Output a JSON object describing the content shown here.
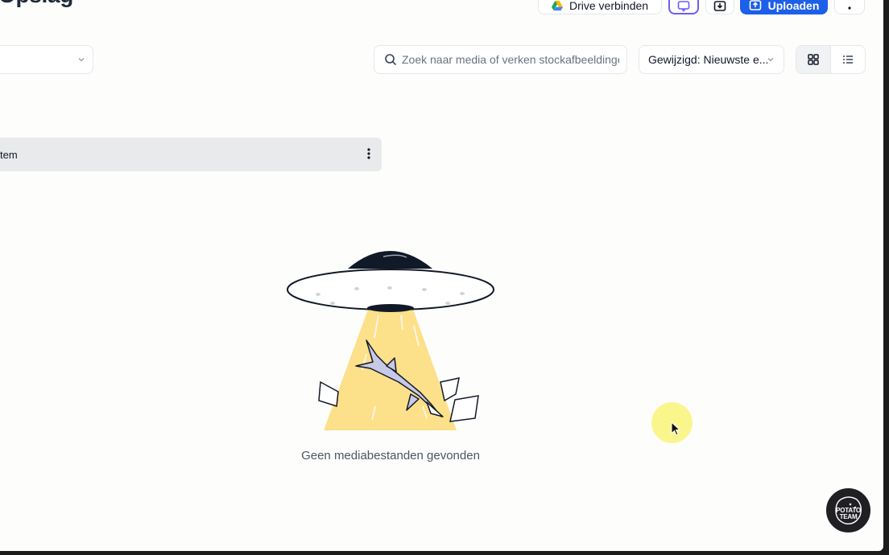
{
  "header": {
    "title": "Opslag",
    "drive_button": "Drive verbinden",
    "upload_button": "Uploaden"
  },
  "toolbar": {
    "search_placeholder": "Zoek naar media of verken stockafbeeldingen",
    "sort_label": "Gewijzigd: Nieuwste e...",
    "view_modes": [
      "grid",
      "list"
    ],
    "active_view": "grid"
  },
  "folder_row": {
    "label": "tem"
  },
  "empty_state": {
    "message": "Geen mediabestanden gevonden"
  },
  "badge": {
    "text_line1": "POTATO",
    "text_line2": "TEAM"
  },
  "icons": {
    "drive": "google-drive-icon",
    "chat": "chat-icon",
    "import": "import-icon",
    "upload": "upload-icon",
    "more": "more-vertical-icon",
    "search": "search-icon",
    "chevron": "chevron-down-icon",
    "grid": "grid-icon",
    "list": "list-icon"
  },
  "colors": {
    "accent": "#1d5fe8",
    "chat_border": "#6d5df5",
    "beam": "#fde08a",
    "cursor_highlight": "#faf578"
  }
}
